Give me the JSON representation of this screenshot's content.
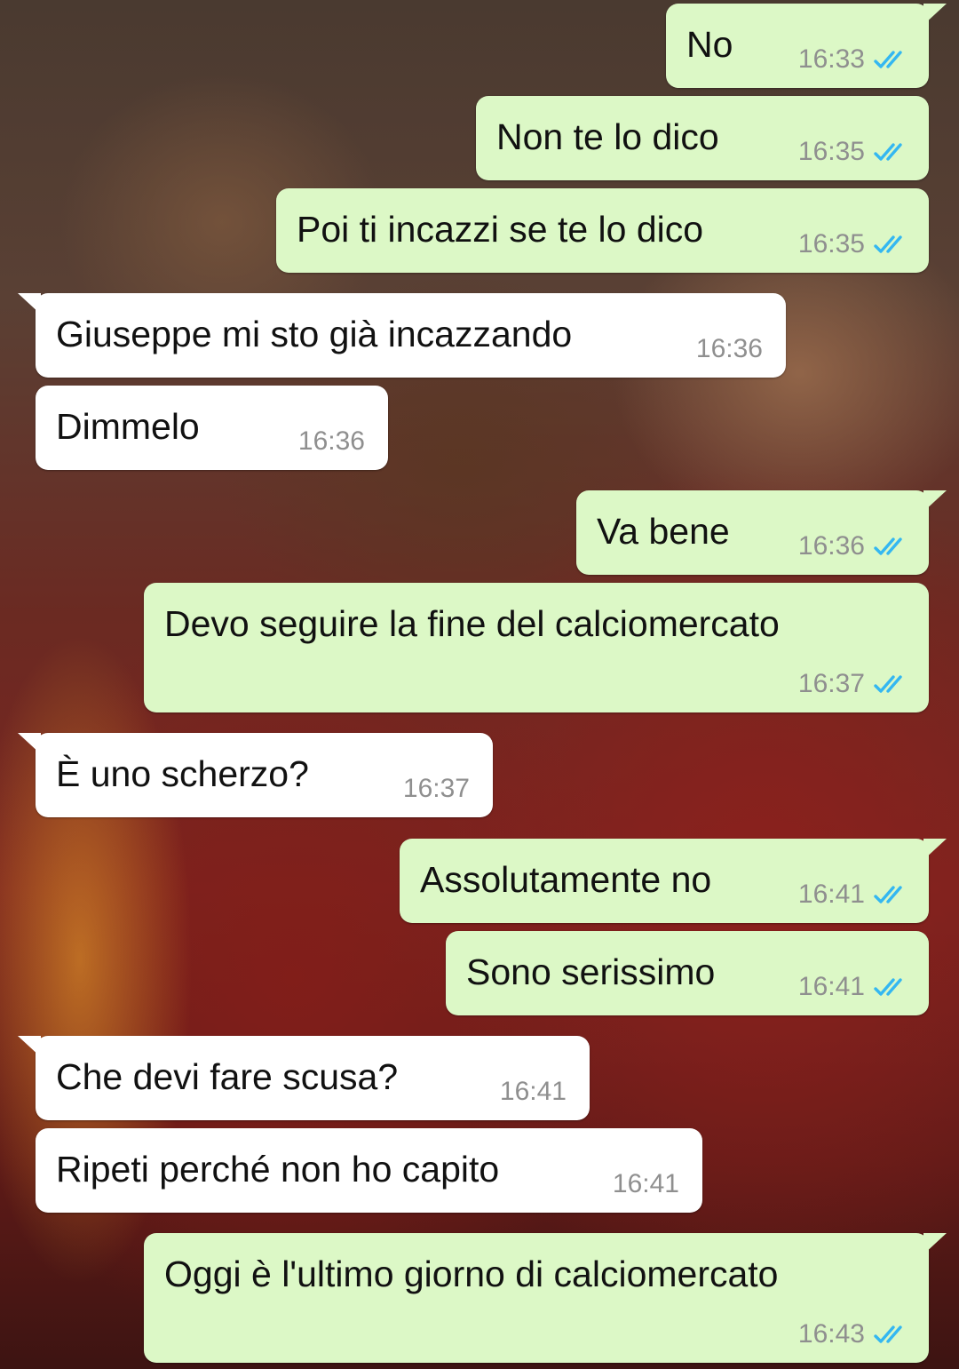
{
  "colors": {
    "outgoing_bubble": "#dcf8c6",
    "incoming_bubble": "#ffffff",
    "read_ticks": "#34b7f1",
    "time_text": "#8f8f8f"
  },
  "icons": {
    "read_receipt": "double-check-icon"
  },
  "messages": [
    {
      "dir": "out",
      "text": "No",
      "time": "16:33",
      "read": true
    },
    {
      "dir": "out",
      "text": "Non te lo dico",
      "time": "16:35",
      "read": true
    },
    {
      "dir": "out",
      "text": "Poi ti incazzi se te lo dico",
      "time": "16:35",
      "read": true
    },
    {
      "dir": "in",
      "text": "Giuseppe mi sto già incazzando",
      "time": "16:36"
    },
    {
      "dir": "in",
      "text": "Dimmelo",
      "time": "16:36"
    },
    {
      "dir": "out",
      "text": "Va bene",
      "time": "16:36",
      "read": true
    },
    {
      "dir": "out",
      "text": "Devo seguire la fine del calciomercato",
      "time": "16:37",
      "read": true
    },
    {
      "dir": "in",
      "text": "È uno scherzo?",
      "time": "16:37"
    },
    {
      "dir": "out",
      "text": "Assolutamente no",
      "time": "16:41",
      "read": true
    },
    {
      "dir": "out",
      "text": "Sono serissimo",
      "time": "16:41",
      "read": true
    },
    {
      "dir": "in",
      "text": "Che devi fare scusa?",
      "time": "16:41"
    },
    {
      "dir": "in",
      "text": "Ripeti perché non ho capito",
      "time": "16:41"
    },
    {
      "dir": "out",
      "text": "Oggi è l'ultimo giorno di calciomercato",
      "time": "16:43",
      "read": true
    }
  ]
}
